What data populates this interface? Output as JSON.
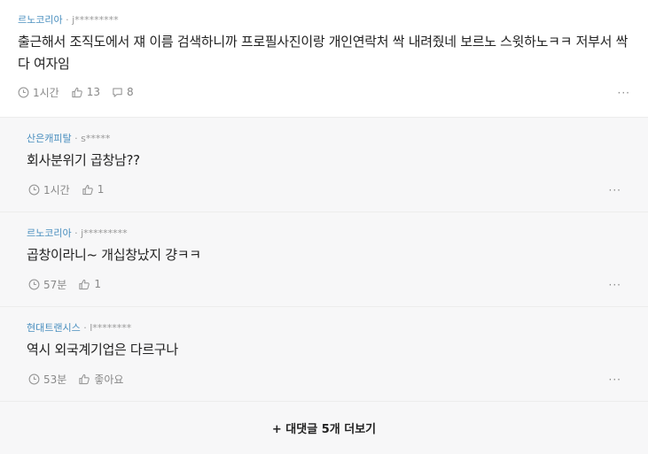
{
  "post": {
    "company": "르노코리아",
    "user": "j*********",
    "content": "출근해서 조직도에서 쟤 이름 검색하니까 프로필사진이랑 개인연락처 싹 내려줬네 보르노 스윗하노ㅋㅋ 저부서 싹다 여자임",
    "time": "1시간",
    "likes": "13",
    "comments": "8",
    "more": "···"
  },
  "replies": [
    {
      "company": "산은캐피탈",
      "user": "s*****",
      "content": "회사분위기 곱창남??",
      "time": "1시간",
      "likes": "1",
      "more": "···"
    },
    {
      "company": "르노코리아",
      "user": "j*********",
      "content": "곱창이라니~ 개십창났지 걍ㅋㅋ",
      "time": "57분",
      "likes": "1",
      "more": "···"
    },
    {
      "company": "현대트랜시스",
      "user": "l********",
      "content": "역시 외국계기업은 다르구나",
      "time": "53분",
      "likes": "좋아요",
      "more": "···"
    }
  ],
  "separator": "·",
  "load_more": "+ 대댓글 5개 더보기",
  "colors": {
    "company": "#4a8fbf",
    "reply_bg": "#f7f7f8",
    "meta": "#999999"
  },
  "icons": [
    "clock-icon",
    "thumbs-up-icon",
    "comment-icon",
    "more-options-icon"
  ]
}
